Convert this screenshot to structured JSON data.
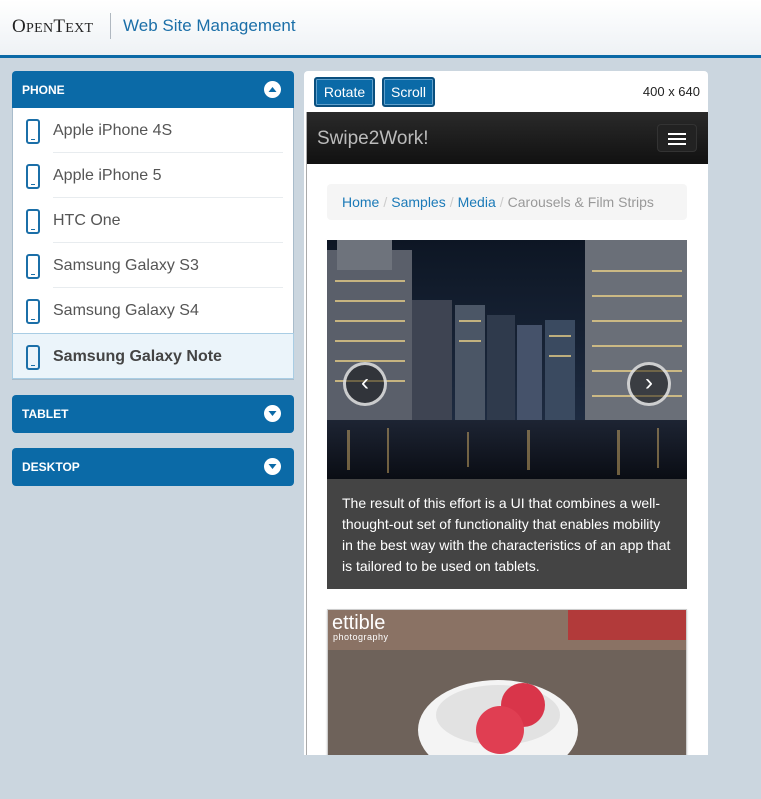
{
  "header": {
    "logo_text": "OpenText",
    "product_name": "Web Site Management"
  },
  "sidebar": {
    "phone": {
      "label": "PHONE",
      "expanded": true,
      "devices": [
        {
          "name": "Apple iPhone 4S",
          "selected": false
        },
        {
          "name": "Apple iPhone 5",
          "selected": false
        },
        {
          "name": "HTC One",
          "selected": false
        },
        {
          "name": "Samsung Galaxy S3",
          "selected": false
        },
        {
          "name": "Samsung Galaxy S4",
          "selected": false
        },
        {
          "name": "Samsung Galaxy Note",
          "selected": true
        }
      ]
    },
    "tablet": {
      "label": "TABLET",
      "expanded": false
    },
    "desktop": {
      "label": "DESKTOP",
      "expanded": false
    }
  },
  "preview": {
    "rotate_label": "Rotate",
    "scroll_label": "Scroll",
    "dimensions": "400 x 640"
  },
  "site": {
    "brand": "Swipe2Work!",
    "breadcrumb": {
      "home": "Home",
      "samples": "Samples",
      "media": "Media",
      "current": "Carousels & Film Strips"
    },
    "carousel": {
      "prev_glyph": "‹",
      "next_glyph": "›",
      "caption": "The result of this effort is a UI that combines a well-thought-out set of functionality that enables mobility in the best way with the characteristics of an app that is tailored to be used on tablets."
    },
    "photo_watermark": "ettible",
    "photo_watermark_sub": "photography"
  },
  "colors": {
    "accent": "#0b6aa7",
    "background": "#cbd6df",
    "navbar": "#1a1a1a",
    "link": "#1b7ab8"
  }
}
